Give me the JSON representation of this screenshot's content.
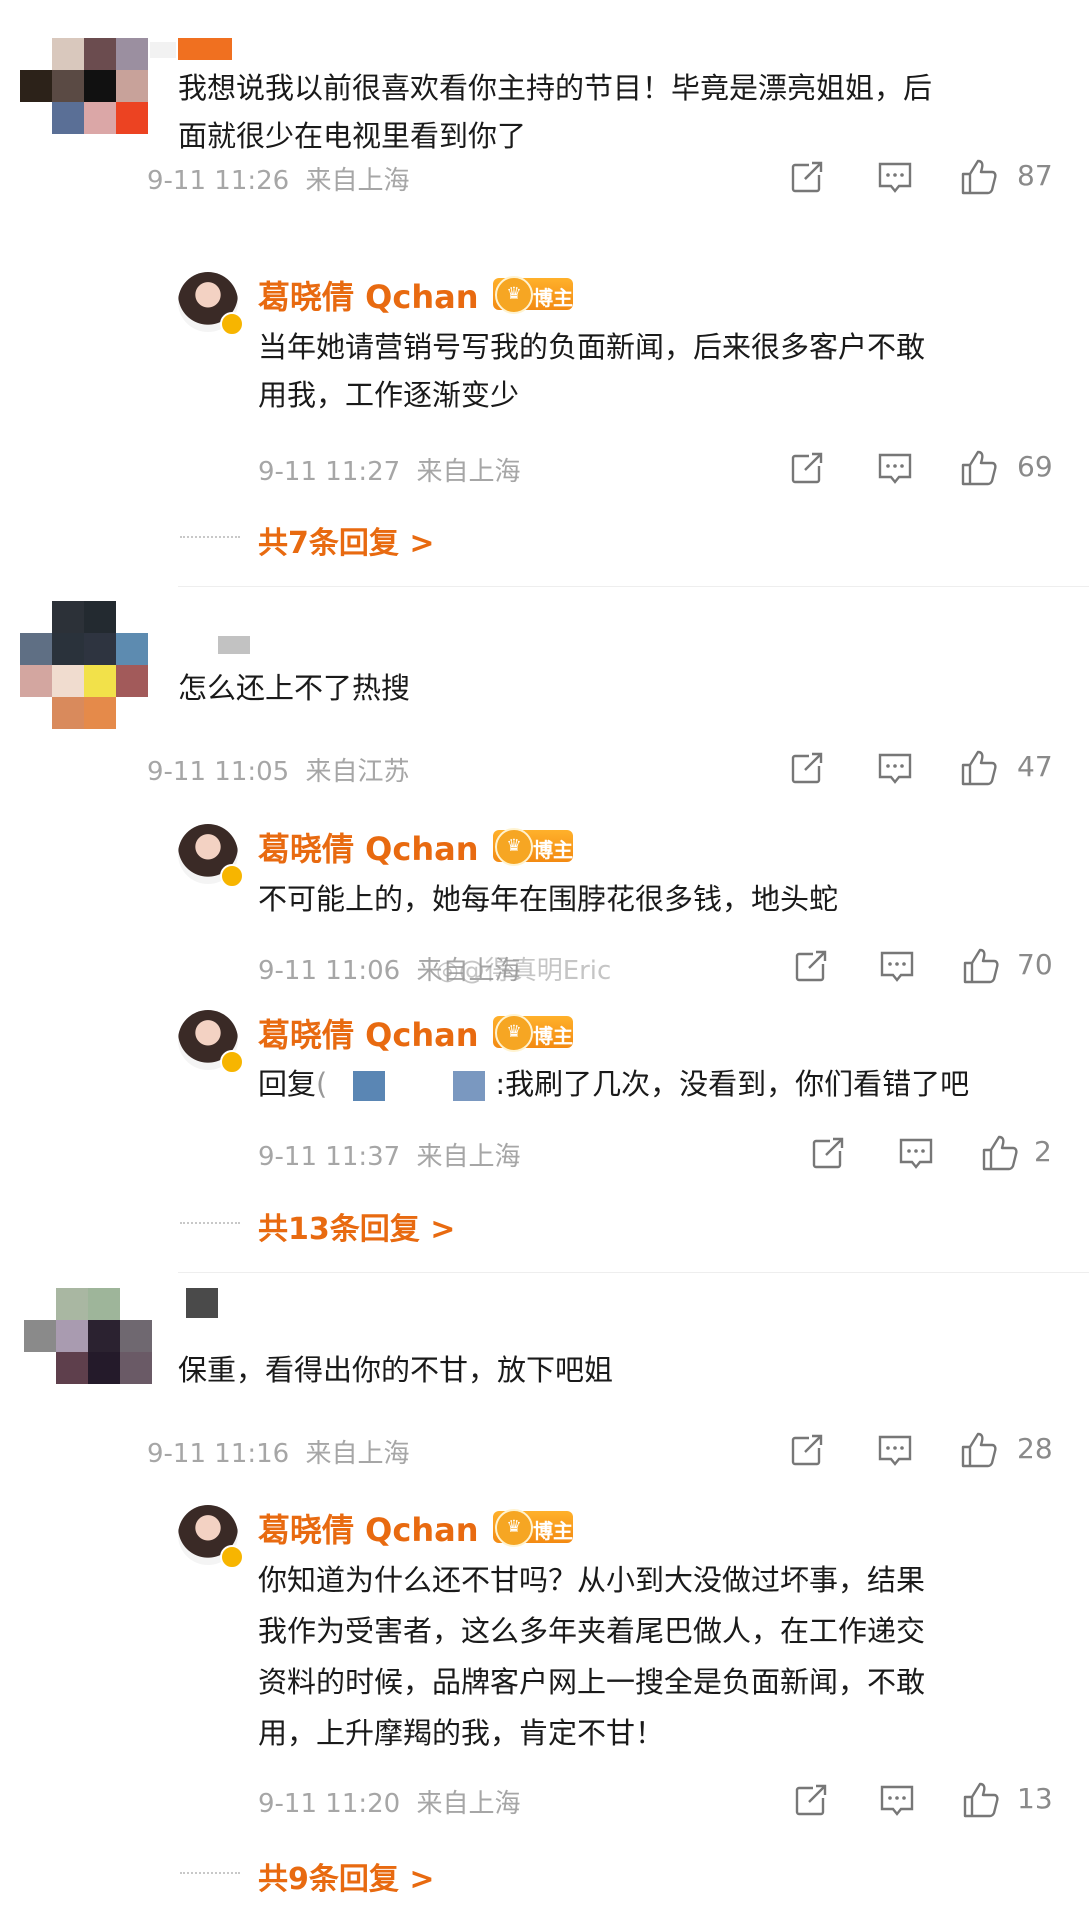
{
  "icons": {
    "repost": "repost-icon",
    "comment": "comment-icon",
    "like": "like-icon"
  },
  "colors": {
    "author": "#e86a10",
    "meta": "#a6a6a6",
    "badge": "#f38a12"
  },
  "threads": [
    {
      "comment": {
        "text_line1": "我想说我以前很喜欢看你主持的节目！毕竟是漂亮姐姐，后",
        "text_line2": "面就很少在电视里看到你了",
        "time": "9-11 11:26",
        "location": "来自上海",
        "likes": "87"
      },
      "replies": [
        {
          "author": "葛晓倩 Qchan",
          "badge": "博主",
          "text_line1": "当年她请营销号写我的负面新闻，后来很多客户不敢",
          "text_line2": "用我，工作逐渐变少",
          "time": "9-11 11:27",
          "location": "来自上海",
          "likes": "69"
        }
      ],
      "more": "共7条回复 >"
    },
    {
      "comment": {
        "text_line1": "怎么还上不了热搜",
        "time": "9-11 11:05",
        "location": "来自江苏",
        "likes": "47"
      },
      "replies": [
        {
          "author": "葛晓倩 Qchan",
          "badge": "博主",
          "text_line1": "不可能上的，她每年在围脖花很多钱，地头蛇",
          "time": "9-11 11:06",
          "location": "来自上海",
          "likes": "70"
        },
        {
          "author": "葛晓倩 Qchan",
          "badge": "博主",
          "text_prefix": "回复",
          "text_suffix": ":我刷了几次，没看到，你们看错了吧",
          "time": "9-11 11:37",
          "location": "来自上海",
          "likes": "2"
        }
      ],
      "more": "共13条回复 >"
    },
    {
      "comment": {
        "text_line1": "保重，看得出你的不甘，放下吧姐",
        "time": "9-11 11:16",
        "location": "来自上海",
        "likes": "28"
      },
      "replies": [
        {
          "author": "葛晓倩 Qchan",
          "badge": "博主",
          "text_line1": "你知道为什么还不甘吗？从小到大没做过坏事，结果",
          "text_line2": "我作为受害者，这么多年夹着尾巴做人，在工作递交",
          "text_line3": "资料的时候，品牌客户网上一搜全是负面新闻，不敢",
          "text_line4": "用，上升摩羯的我，肯定不甘！",
          "time": "9-11 11:20",
          "location": "来自上海",
          "likes": "13"
        }
      ],
      "more": "共9条回复 >"
    }
  ],
  "watermark": "@得真明Eric"
}
